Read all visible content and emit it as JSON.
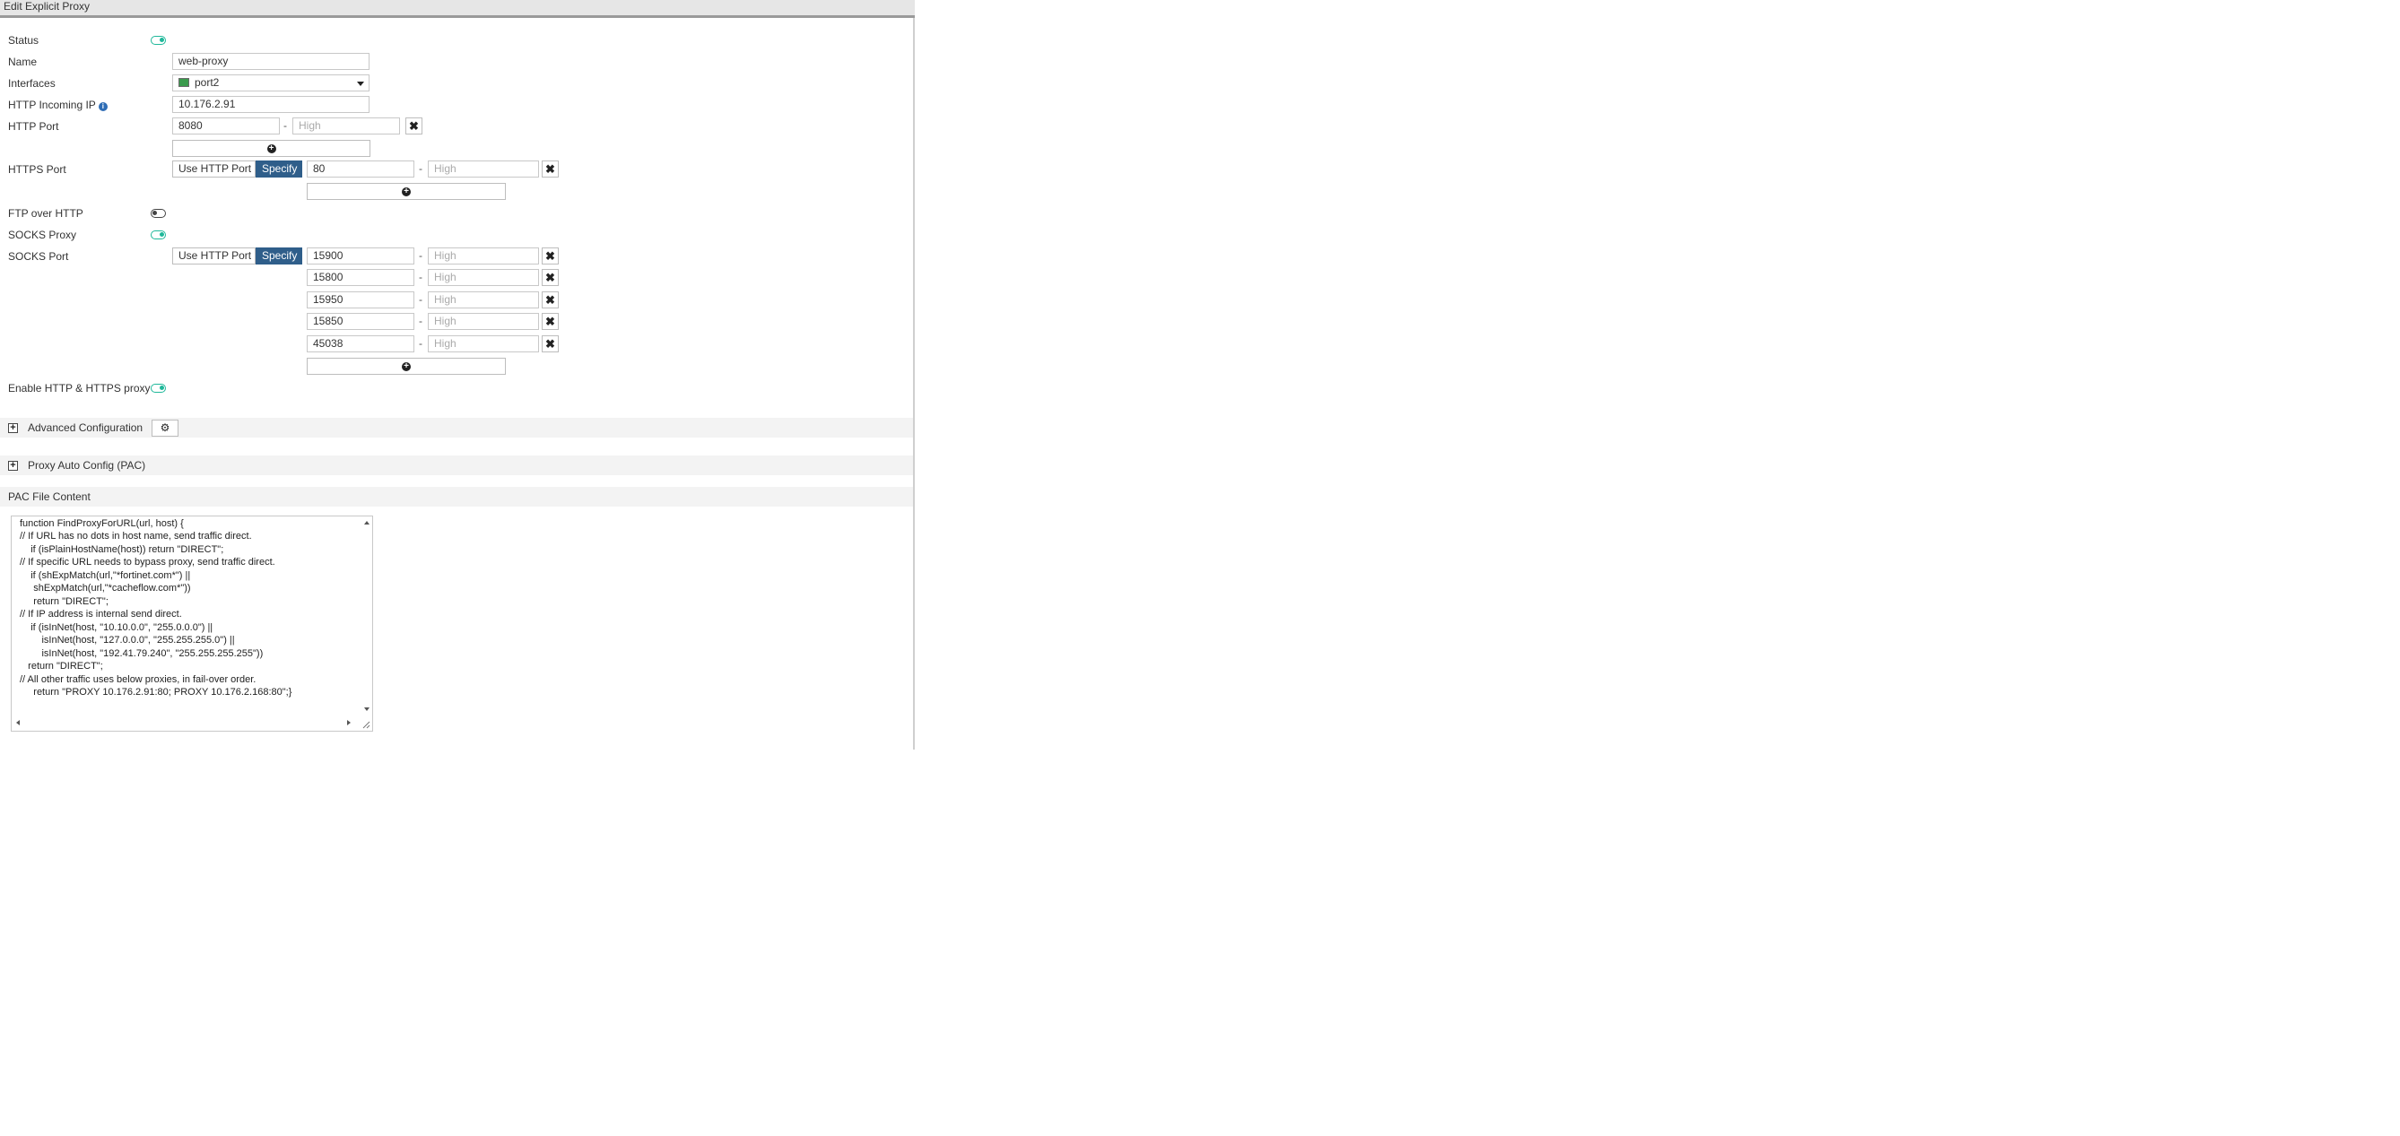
{
  "window": {
    "title": "Edit Explicit Proxy"
  },
  "colors": {
    "toggle_on": "#1fb89a",
    "segment_active": "#2f5e8a"
  },
  "form": {
    "status": {
      "label": "Status",
      "enabled": true
    },
    "name": {
      "label": "Name",
      "value": "web-proxy"
    },
    "interfaces": {
      "label": "Interfaces",
      "value": "port2",
      "icon": "port-flag-icon"
    },
    "http_incoming_ip": {
      "label": "HTTP Incoming IP",
      "value": "10.176.2.91",
      "icon": "info-icon"
    },
    "http_port": {
      "label": "HTTP Port",
      "low": "8080",
      "high_placeholder": "High"
    },
    "https_port": {
      "label": "HTTPS Port",
      "options": [
        "Use HTTP Port",
        "Specify"
      ],
      "selected": "Specify",
      "low": "80",
      "high_placeholder": "High"
    },
    "ftp_over_http": {
      "label": "FTP over HTTP",
      "enabled": false
    },
    "socks_proxy": {
      "label": "SOCKS Proxy",
      "enabled": true
    },
    "socks_port": {
      "label": "SOCKS Port",
      "options": [
        "Use HTTP Port",
        "Specify"
      ],
      "selected": "Specify",
      "ranges": [
        {
          "low": "15900",
          "high_placeholder": "High"
        },
        {
          "low": "15800",
          "high_placeholder": "High"
        },
        {
          "low": "15950",
          "high_placeholder": "High"
        },
        {
          "low": "15850",
          "high_placeholder": "High"
        },
        {
          "low": "45038",
          "high_placeholder": "High"
        }
      ]
    },
    "enable_http_https_proxy": {
      "label": "Enable HTTP & HTTPS proxy",
      "enabled": true
    },
    "range_separator": "-"
  },
  "sections": {
    "advanced": {
      "title": "Advanced Configuration",
      "expand_glyph": "+"
    },
    "pac": {
      "title": "Proxy Auto Config (PAC)",
      "expand_glyph": "+"
    },
    "pac_file": {
      "title": "PAC File Content"
    }
  },
  "pac_content": [
    "function FindProxyForURL(url, host) {",
    "// If URL has no dots in host name, send traffic direct.",
    "    if (isPlainHostName(host)) return \"DIRECT\";",
    "// If specific URL needs to bypass proxy, send traffic direct.",
    "    if (shExpMatch(url,\"*fortinet.com*\") ||",
    "     shExpMatch(url,\"*cacheflow.com*\"))",
    "     return \"DIRECT\";",
    "// If IP address is internal send direct.",
    "    if (isInNet(host, \"10.10.0.0\", \"255.0.0.0\") ||",
    "        isInNet(host, \"127.0.0.0\", \"255.255.255.0\") ||",
    "        isInNet(host, \"192.41.79.240\", \"255.255.255.255\"))",
    "   return \"DIRECT\";",
    "// All other traffic uses below proxies, in fail-over order.",
    "     return \"PROXY 10.176.2.91:80; PROXY 10.176.2.168:80\";}"
  ],
  "glyphs": {
    "remove": "✖",
    "add": "+",
    "gear": "⚙",
    "info": "i"
  }
}
